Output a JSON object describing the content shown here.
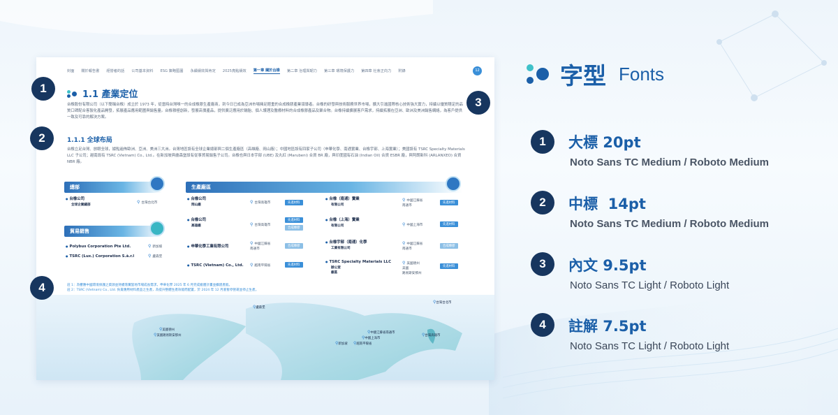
{
  "doc": {
    "nav": [
      "封面",
      "關於報告書",
      "經營者的話",
      "公司基本資料",
      "ESG 策略藍圖",
      "永續績效與肯定",
      "2025亮點績效",
      "第一章 關於台橡",
      "第二章 治理與韌力",
      "第三章 環境保護力",
      "第四章 社會正向力",
      "附錄"
    ],
    "nav_active_index": 7,
    "page_number": "12",
    "section_title": "1.1 產業定位",
    "intro": "台橡股份有限公司（以下簡稱台橡）成立於 1973 年，從當時台灣唯一的合成橡膠生產廠商，到今日已成為亞洲市場擁足輕重的合成橡膠產業領導者。台橡的研發與技術服務世界市場，擴大引進國際核心技術強大實力，持續以優質穩定的品質口碑配合客製化產品開發，拓展產品應用範圍與銷售量。台橡積極創新，發展高價產品，提供廣泛應用於輪胎、個人護理及醫療材料的合成橡膠產品及聚合物。台橡持續擴展客戶需求，持續拓展在亞洲、歐洲及美洲銷售網絡，為客戶提供一致及可靠的解決方案。",
    "subsection_title": "1.1.1 全球布局",
    "global": "台橡立足台灣、放眼全球，據點遍佈歐洲、亞洲、美洲三大洲。台灣地區設有全球企業總部與二個生產廠區（高雄廠、岡山廠）；中國地區設有四家子公司（申華化學、南通實業、台橡宇部、上海實業）；美國設有 TSRC Specialty Materials LLC 子公司；越南設有 TSRC (Vietnam) Co., Ltd.。在新加坡與盧森堡設有從事貿易銷售子公司。台橡也與日本宇部 (UBE) 及丸紅 (Marubeni) 合資 BR 廠，與印度國有石油 (Indian Oil) 合資 ESBR 廠，與阿朗新科 (ARLANXEO) 合資 NBR 廠。",
    "hq": {
      "title": "總部",
      "company": "台橡公司",
      "company2": "全球企業總部",
      "location": "台灣台北市"
    },
    "trade": {
      "title": "貿易銷售",
      "items": [
        {
          "name": "Polybus Corporation Pte Ltd.",
          "location": "新加坡"
        },
        {
          "name": "TSRC (Lux.) Corporation S.à.r.l",
          "location": "盧森堡"
        }
      ]
    },
    "plants": {
      "title": "生產廠區",
      "left": [
        {
          "name": "台橡公司",
          "name2": "岡山廠",
          "location": "台灣高雄市",
          "tags": [
            "先進材料"
          ]
        },
        {
          "name": "台橡公司",
          "name2": "高雄廠",
          "location": "台灣高雄市",
          "tags": [
            "先進材料",
            "合成橡膠"
          ]
        },
        {
          "name": "申華化學工業有限公司",
          "name2": "",
          "location": "中國江蘇省\n南通市",
          "tags": [
            "合成橡膠"
          ]
        },
        {
          "name": "TSRC (Vietnam) Co., Ltd.",
          "name2": "",
          "location": "越南平陽省",
          "tags": [
            "先進材料"
          ]
        }
      ],
      "right": [
        {
          "name": "台橡（南通）實業",
          "name2": "有限公司",
          "location": "中國江蘇省\n南通市",
          "tags": [
            "先進材料"
          ]
        },
        {
          "name": "台橡（上海）實業",
          "name2": "有限公司",
          "location": "中國上海市",
          "tags": [
            "先進材料"
          ]
        },
        {
          "name": "台橡宇部（南通）化學",
          "name2": "工業有限公司",
          "location": "中國江蘇省\n南通市",
          "tags": [
            "合成橡膠"
          ]
        },
        {
          "name": "TSRC Specialty Materials LLC",
          "name2": "辦公室\n廠區",
          "location": "美國德州\n美國\n路易斯安那州",
          "tags": [
            "先進材料"
          ]
        }
      ]
    },
    "notes": [
      "註 1：為響應中國環境保護之資源並持續落實當地市場成長需求，申華化學 2025 年 6 月完成搬遷計畫並擴建產能。",
      "註 2：TSRC (Vietnam) Co., Ltd. 負責應用材料產品之生產，為提升整體生產效能而配置，於 2024 年 12 月底暫停營運並停止生產。"
    ],
    "map_pins": [
      "盧森堡",
      "美國德州",
      "美國路易斯安那州",
      "中國江蘇省南通市",
      "中國上海市",
      "越南平陽省",
      "新加坡",
      "台灣台北市",
      "台灣高雄市"
    ]
  },
  "markers": [
    "1",
    "2",
    "3",
    "4"
  ],
  "legend": {
    "heading_zh": "字型",
    "heading_en": "Fonts",
    "items": [
      {
        "num": "1",
        "title": "大標 20pt",
        "font": "Noto Sans TC Medium / Roboto Medium"
      },
      {
        "num": "2",
        "title": "中標  14pt",
        "font": "Noto Sans TC Medium / Roboto Medium"
      },
      {
        "num": "3",
        "title": "內文 9.5pt",
        "font": "Noto Sans TC Light / Roboto Light"
      },
      {
        "num": "4",
        "title": "註解 7.5pt",
        "font": "Noto Sans TC Light / Roboto Light"
      }
    ]
  },
  "colors": {
    "brand_blue": "#1b5fa8",
    "marker_navy": "#17365f",
    "accent_cyan": "#3fc1c9"
  }
}
